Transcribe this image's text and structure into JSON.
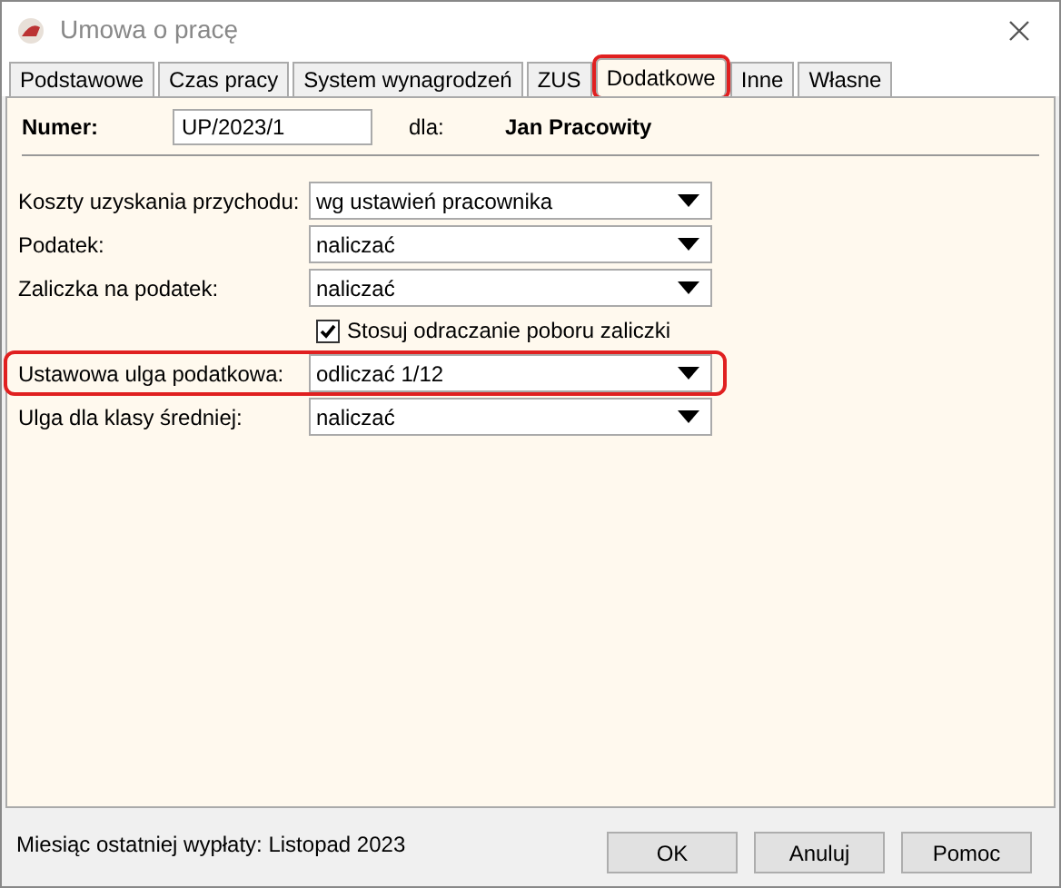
{
  "window": {
    "title": "Umowa o pracę"
  },
  "tabs": [
    {
      "label": "Podstawowe",
      "selected": false,
      "highlighted": false
    },
    {
      "label": "Czas pracy",
      "selected": false,
      "highlighted": false
    },
    {
      "label": "System wynagrodzeń",
      "selected": false,
      "highlighted": false
    },
    {
      "label": "ZUS",
      "selected": false,
      "highlighted": false
    },
    {
      "label": "Dodatkowe",
      "selected": true,
      "highlighted": true
    },
    {
      "label": "Inne",
      "selected": false,
      "highlighted": false
    },
    {
      "label": "Własne",
      "selected": false,
      "highlighted": false
    }
  ],
  "header": {
    "number_label": "Numer:",
    "number_value": "UP/2023/1",
    "for_label": "dla:",
    "employee": "Jan Pracowity"
  },
  "fields": [
    {
      "kind": "select",
      "label": "Koszty uzyskania przychodu:",
      "value": "wg ustawień pracownika",
      "highlighted": false
    },
    {
      "kind": "select",
      "label": "Podatek:",
      "value": "naliczać",
      "highlighted": false
    },
    {
      "kind": "select",
      "label": "Zaliczka na podatek:",
      "value": "naliczać",
      "highlighted": false
    },
    {
      "kind": "checkbox",
      "label": "Stosuj odraczanie poboru zaliczki",
      "checked": true
    },
    {
      "kind": "select",
      "label": "Ustawowa ulga podatkowa:",
      "value": "odliczać 1/12",
      "highlighted": true
    },
    {
      "kind": "select",
      "label": "Ulga dla klasy średniej:",
      "value": "naliczać",
      "highlighted": false
    }
  ],
  "status": "Miesiąc ostatniej wypłaty: Listopad 2023",
  "buttons": [
    "OK",
    "Anuluj",
    "Pomoc"
  ]
}
